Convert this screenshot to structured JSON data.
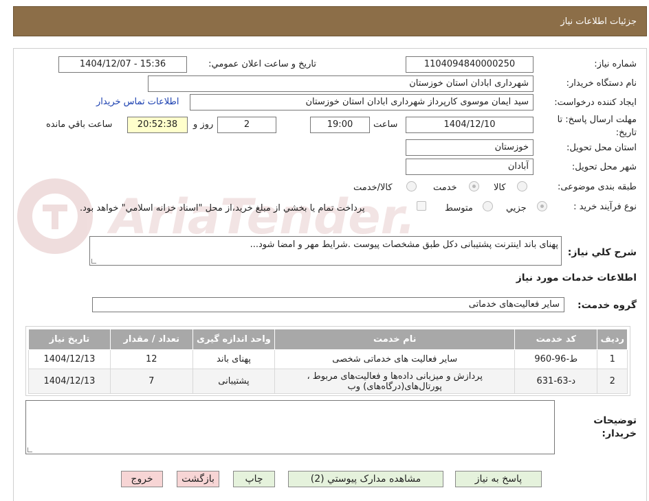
{
  "header": {
    "title": "جزئيات اطلاعات نياز"
  },
  "watermark": {
    "text": "AriaTender.neT"
  },
  "form": {
    "need_number_label": "شماره نياز:",
    "need_number": "1104094840000250",
    "announce_label": "تاريخ و ساعت اعلان عمومي:",
    "announce_value": "1404/12/07 - 15:36",
    "buyer_org_label": "نام دستگاه خريدار:",
    "buyer_org": "شهرداری ابادان استان خوزستان",
    "creator_label": "ايجاد كننده درخواست:",
    "creator": "سید ایمان موسوی کارپرداز شهرداری ابادان استان خوزستان",
    "contact_link": "اطلاعات تماس خريدار",
    "deadline_label": "مهلت ارسال پاسخ: تا تاريخ:",
    "deadline_date": "1404/12/10",
    "time_label": "ساعت",
    "deadline_time": "19:00",
    "days_value": "2",
    "days_label": "روز و",
    "remaining_time": "20:52:38",
    "remaining_label": "ساعت باقي مانده",
    "province_label": "استان محل تحويل:",
    "province": "خوزستان",
    "city_label": "شهر محل تحويل:",
    "city": "آبادان",
    "category_label": "طبقه بندی موضوعی:",
    "category_options": [
      "كالا",
      "خدمت",
      "كالا/خدمت"
    ],
    "category_selected": "خدمت",
    "process_label": "نوع فرآيند خريد :",
    "process_options": [
      "جزيي",
      "متوسط"
    ],
    "process_selected": "جزيي",
    "payment_note": "پرداخت تمام يا بخشي از مبلغ خريد،از محل \"اسناد خزانه اسلامي\" خواهد بود.",
    "description_label": "شرح كلي نياز:",
    "description": "پهنای باند اینترنت پشتیبانی دکل طبق مشخصات پیوست .شرایط مهر و امضا شود..."
  },
  "services": {
    "section_title": "اطلاعات خدمات مورد نياز",
    "group_label": "گروه خدمت:",
    "group_value": "ساير فعاليت‌هاى خدماتى",
    "columns": [
      "رديف",
      "كد خدمت",
      "نام خدمت",
      "واحد اندازه گيری",
      "تعداد / مقدار",
      "تاريخ نياز"
    ],
    "rows": [
      {
        "row": "1",
        "code": "ط-96-960",
        "name": "ساير فعاليت هاى خدماتى شخصى",
        "unit": "پهنای باند",
        "qty": "12",
        "date": "1404/12/13"
      },
      {
        "row": "2",
        "code": "د-63-631",
        "name": "پردازش و ميزبانى داده‌ها و فعاليت‌هاى مربوط ، پورتال‌هاى(درگاه‌هاى) وب",
        "unit": "پشتیبانی",
        "qty": "7",
        "date": "1404/12/13"
      }
    ]
  },
  "buyer_notes": {
    "label": "توضيحات خريدار:",
    "value": ""
  },
  "buttons": {
    "reply": "پاسخ به نياز",
    "view_docs": "مشاهده مدارک پيوستي (2)",
    "print": "چاپ",
    "back": "بازگشت",
    "exit": "خروج"
  }
}
